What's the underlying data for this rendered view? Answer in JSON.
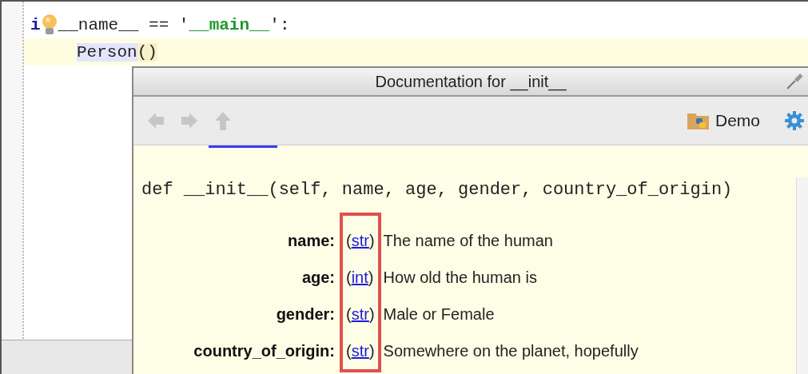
{
  "editor": {
    "lines": [
      {
        "current": false,
        "tokens": [
          {
            "text": "i",
            "kind": "keyword"
          },
          {
            "text": "__name__ == ",
            "kind": "plain"
          },
          {
            "text": "'",
            "kind": "plain"
          },
          {
            "text": "__main__",
            "kind": "string"
          },
          {
            "text": "':",
            "kind": "plain"
          }
        ]
      },
      {
        "current": true,
        "tokens": [
          {
            "text": "Person",
            "kind": "highlighted"
          },
          {
            "text": "()",
            "kind": "paren"
          }
        ]
      }
    ]
  },
  "popup": {
    "title": "Documentation for __init__",
    "navigation": [
      {
        "kind": "back",
        "disabled": true
      },
      {
        "kind": "forward",
        "disabled": true
      },
      {
        "kind": "up",
        "disabled": true
      }
    ],
    "project": "Demo",
    "signature": "def __init__(self, name, age, gender, country_of_origin)",
    "params": [
      {
        "name": "name:",
        "open": "(",
        "type": "str",
        "close": ")",
        "description": "The name of the human"
      },
      {
        "name": "age:",
        "open": "(",
        "type": "int",
        "close": ")",
        "description": "How old the human is"
      },
      {
        "name": "gender:",
        "open": "(",
        "type": "str",
        "close": ")",
        "description": "Male or Female"
      },
      {
        "name": "country_of_origin:",
        "open": "(",
        "type": "str",
        "close": ")",
        "description": "Somewhere on the planet, hopefully"
      }
    ]
  }
}
